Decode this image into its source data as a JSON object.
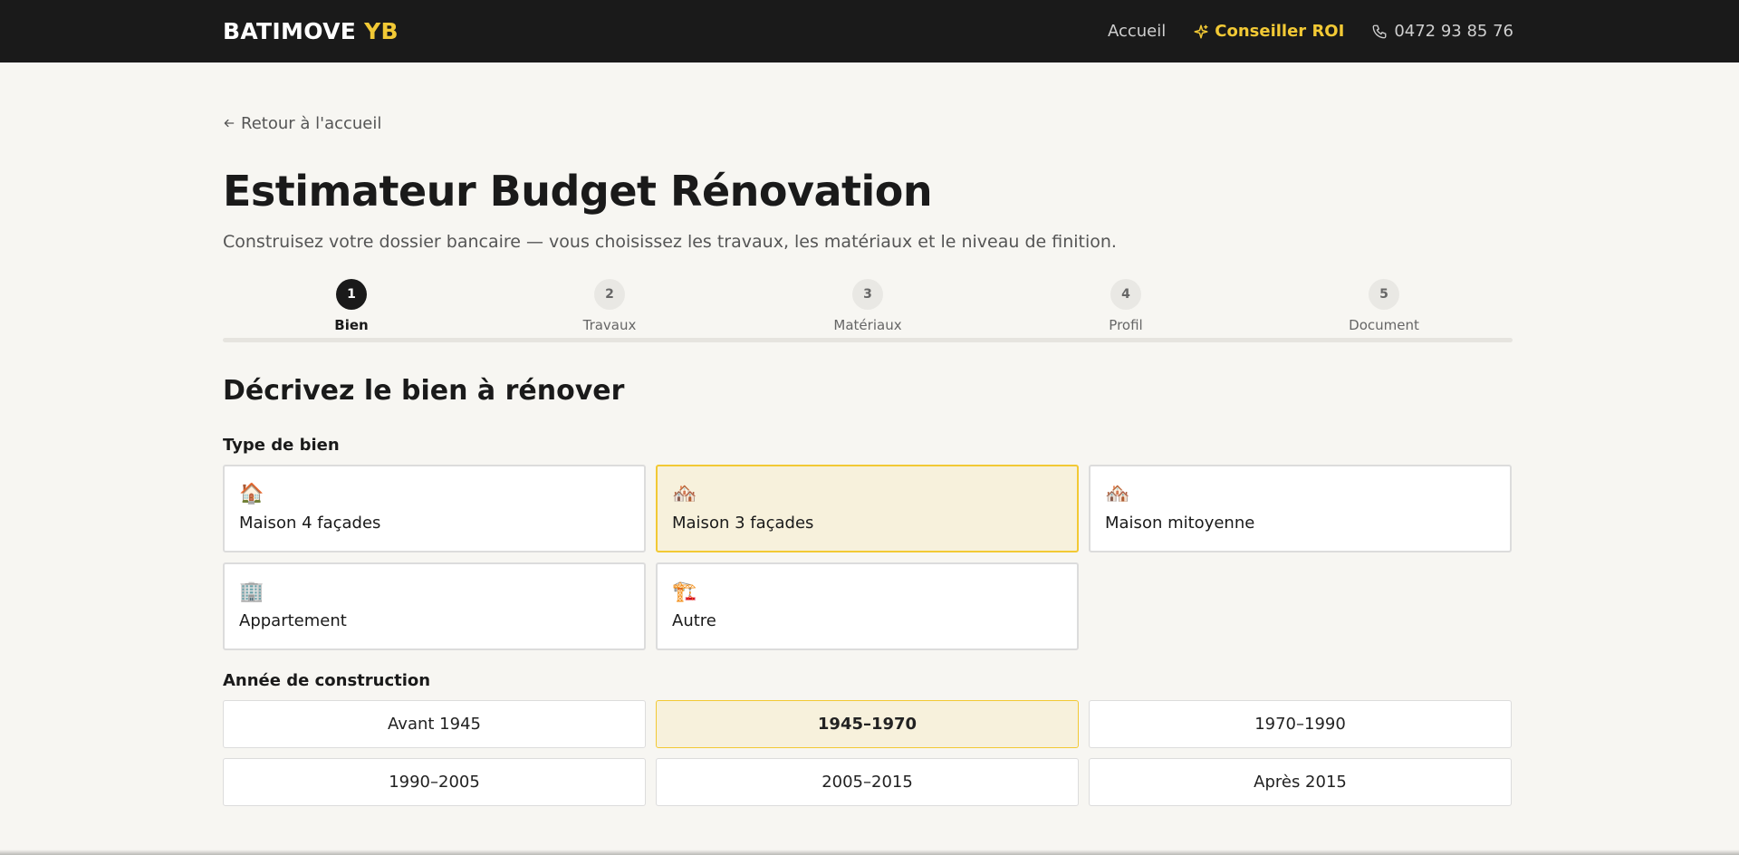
{
  "header": {
    "brand_main": "BATIMOVE",
    "brand_accent": "YB",
    "nav_home": "Accueil",
    "nav_roi": "Conseiller ROI",
    "nav_phone": "0472 93 85 76"
  },
  "page": {
    "back_label": "Retour à l'accueil",
    "title": "Estimateur Budget Rénovation",
    "subtitle": "Construisez votre dossier bancaire — vous choisissez les travaux, les matériaux et le niveau de finition."
  },
  "steps": [
    {
      "number": "1",
      "label": "Bien",
      "active": true
    },
    {
      "number": "2",
      "label": "Travaux",
      "active": false
    },
    {
      "number": "3",
      "label": "Matériaux",
      "active": false
    },
    {
      "number": "4",
      "label": "Profil",
      "active": false
    },
    {
      "number": "5",
      "label": "Document",
      "active": false
    }
  ],
  "form": {
    "section_title": "Décrivez le bien à rénover",
    "type_label": "Type de bien",
    "types": [
      {
        "emoji": "🏠",
        "label": "Maison 4 façades",
        "selected": false
      },
      {
        "emoji": "🏘️",
        "label": "Maison 3 façades",
        "selected": true
      },
      {
        "emoji": "🏘️",
        "label": "Maison mitoyenne",
        "selected": false
      },
      {
        "emoji": "🏢",
        "label": "Appartement",
        "selected": false
      },
      {
        "emoji": "🏗️",
        "label": "Autre",
        "selected": false
      }
    ],
    "year_label": "Année de construction",
    "years": [
      {
        "label": "Avant 1945",
        "selected": false
      },
      {
        "label": "1945–1970",
        "selected": true
      },
      {
        "label": "1970–1990",
        "selected": false
      },
      {
        "label": "1990–2005",
        "selected": false
      },
      {
        "label": "2005–2015",
        "selected": false
      },
      {
        "label": "Après 2015",
        "selected": false
      }
    ]
  },
  "colors": {
    "accent": "#f2c935",
    "topbar": "#1a1a1a",
    "selected_bg": "#f7f1dc",
    "page_bg": "#f7f6f2"
  },
  "icons": {
    "back": "arrow-left-icon",
    "roi": "sparkle-icon",
    "phone": "phone-icon"
  }
}
